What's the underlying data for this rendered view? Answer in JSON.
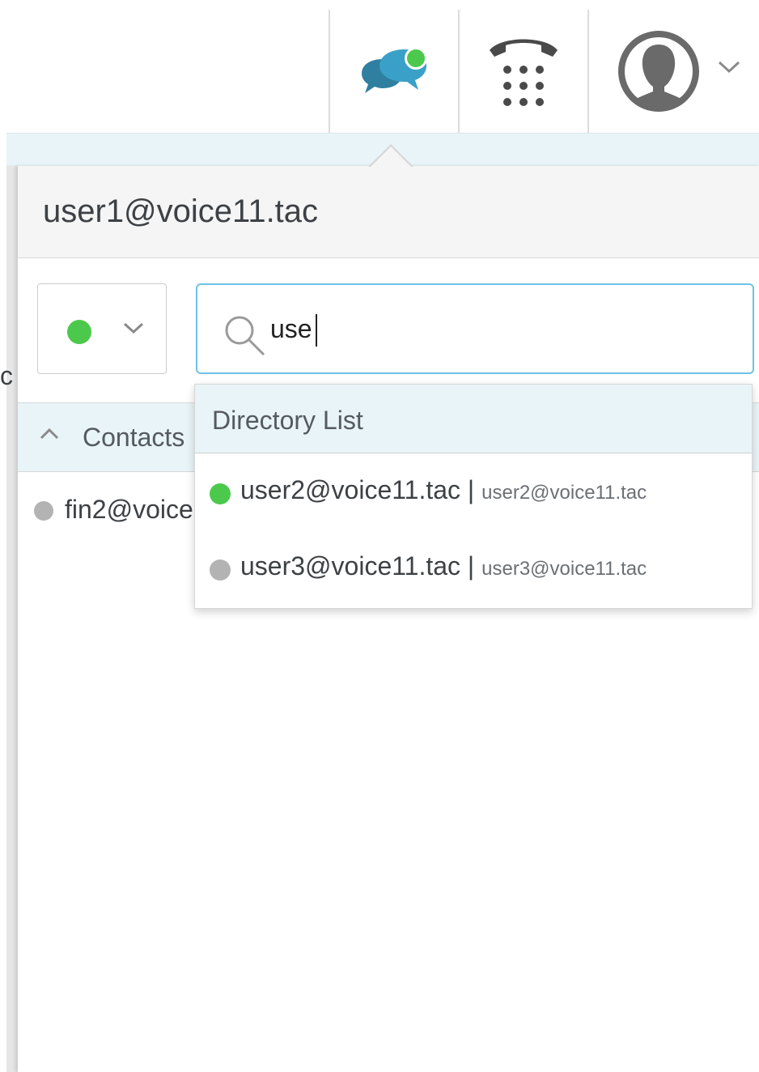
{
  "toolbar": {
    "chat_icon": "chat-bubbles-icon",
    "chat_status_color": "#4cc94c",
    "dialpad_icon": "dialpad-icon",
    "avatar_icon": "user-avatar-icon",
    "avatar_menu_icon": "chevron-down-icon"
  },
  "panel": {
    "title": "user1@voice11.tac",
    "presence_color": "#4cc94c",
    "search": {
      "value": "use",
      "icon": "search-icon"
    },
    "contacts": {
      "header_label": "Contacts",
      "items": [
        {
          "name": "fin2@voice",
          "status_color": "#b3b3b3"
        }
      ]
    },
    "left_fragment": "c"
  },
  "directory": {
    "header": "Directory List",
    "items": [
      {
        "name": "user2@voice11.tac",
        "separator": "|",
        "secondary": "user2@voice11.tac",
        "status_color": "#4cc94c"
      },
      {
        "name": "user3@voice11.tac",
        "separator": "|",
        "secondary": "user3@voice11.tac",
        "status_color": "#b3b3b3"
      }
    ]
  },
  "colors": {
    "accent": "#6ec2e4",
    "online": "#4cc94c",
    "offline": "#b3b3b3",
    "header_bg": "#e8f4f8"
  }
}
